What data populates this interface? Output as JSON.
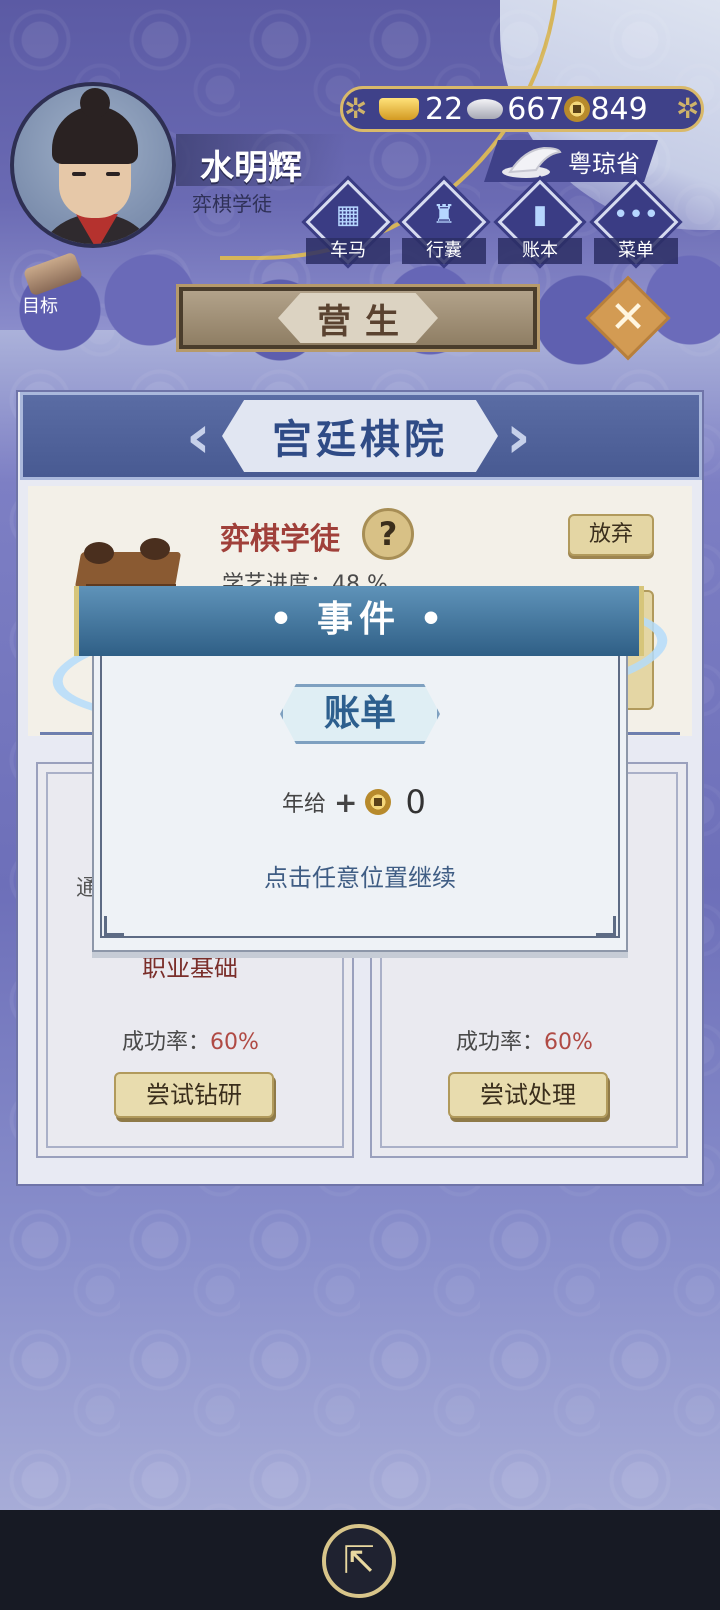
{
  "player": {
    "name": "水明辉",
    "title": "弈棋学徒"
  },
  "resources": {
    "gold": "22",
    "silver": "667",
    "coins": "849"
  },
  "location": "粤琼省",
  "menu": [
    {
      "label": "车马",
      "icon": "carriage-icon"
    },
    {
      "label": "行囊",
      "icon": "bag-icon"
    },
    {
      "label": "账本",
      "icon": "ledger-icon"
    },
    {
      "label": "菜单",
      "icon": "more-icon"
    }
  ],
  "goal_label": "目标",
  "banner_title": "营生",
  "panel": {
    "title": "宫廷棋院",
    "career_name": "弈棋学徒",
    "progress": "学艺进度：48 %",
    "quit_label": "放弃",
    "cards": [
      {
        "clipped_text": "通",
        "subtitle": "职业基础",
        "rate_label": "成功率：",
        "rate_value": "60%",
        "button": "尝试钻研"
      },
      {
        "rate_label": "成功率：",
        "rate_value": "60%",
        "button": "尝试处理"
      }
    ]
  },
  "event": {
    "header": "• 事件 •",
    "tag": "账单",
    "income_label": "年给",
    "income_sign": "+",
    "income_value": "0",
    "hint": "点击任意位置继续"
  },
  "colors": {
    "accent_gold": "#d6b55a",
    "panel_blue": "#485a92",
    "dialog_blue": "#2f5f86"
  }
}
